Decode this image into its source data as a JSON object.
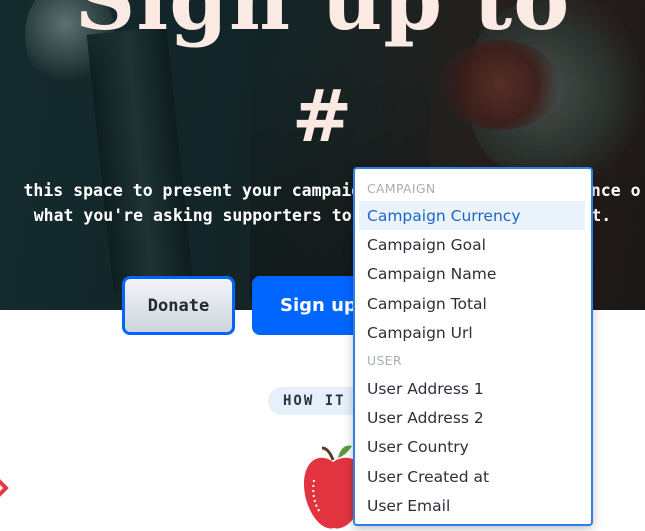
{
  "hero": {
    "title_line1": "Sign up to",
    "title_line2": "#",
    "subtitle_line1": "this space to present your campaign's e",
    "subtitle_line1_tail": "ence o",
    "subtitle_line2": "what you're asking supporters to",
    "subtitle_line2_tail": "do it."
  },
  "buttons": {
    "donate": "Donate",
    "signup": "Sign up"
  },
  "section": {
    "how_it_pill": "HOW IT"
  },
  "dropdown": {
    "groups": [
      {
        "label": "CAMPAIGN",
        "items": [
          "Campaign Currency",
          "Campaign Goal",
          "Campaign Name",
          "Campaign Total",
          "Campaign Url"
        ]
      },
      {
        "label": "USER",
        "items": [
          "User Address 1",
          "User Address 2",
          "User Country",
          "User Created at",
          "User Email"
        ]
      }
    ],
    "highlighted_item": "Campaign Currency"
  },
  "icons": {
    "apple": "apple-icon",
    "arrow": "arrow-icon"
  },
  "colors": {
    "accent": "#0066ff",
    "hero_text": "#fbe9e4",
    "dropdown_border": "#2f7fe6",
    "dropdown_highlight": "#eaf2fc"
  }
}
